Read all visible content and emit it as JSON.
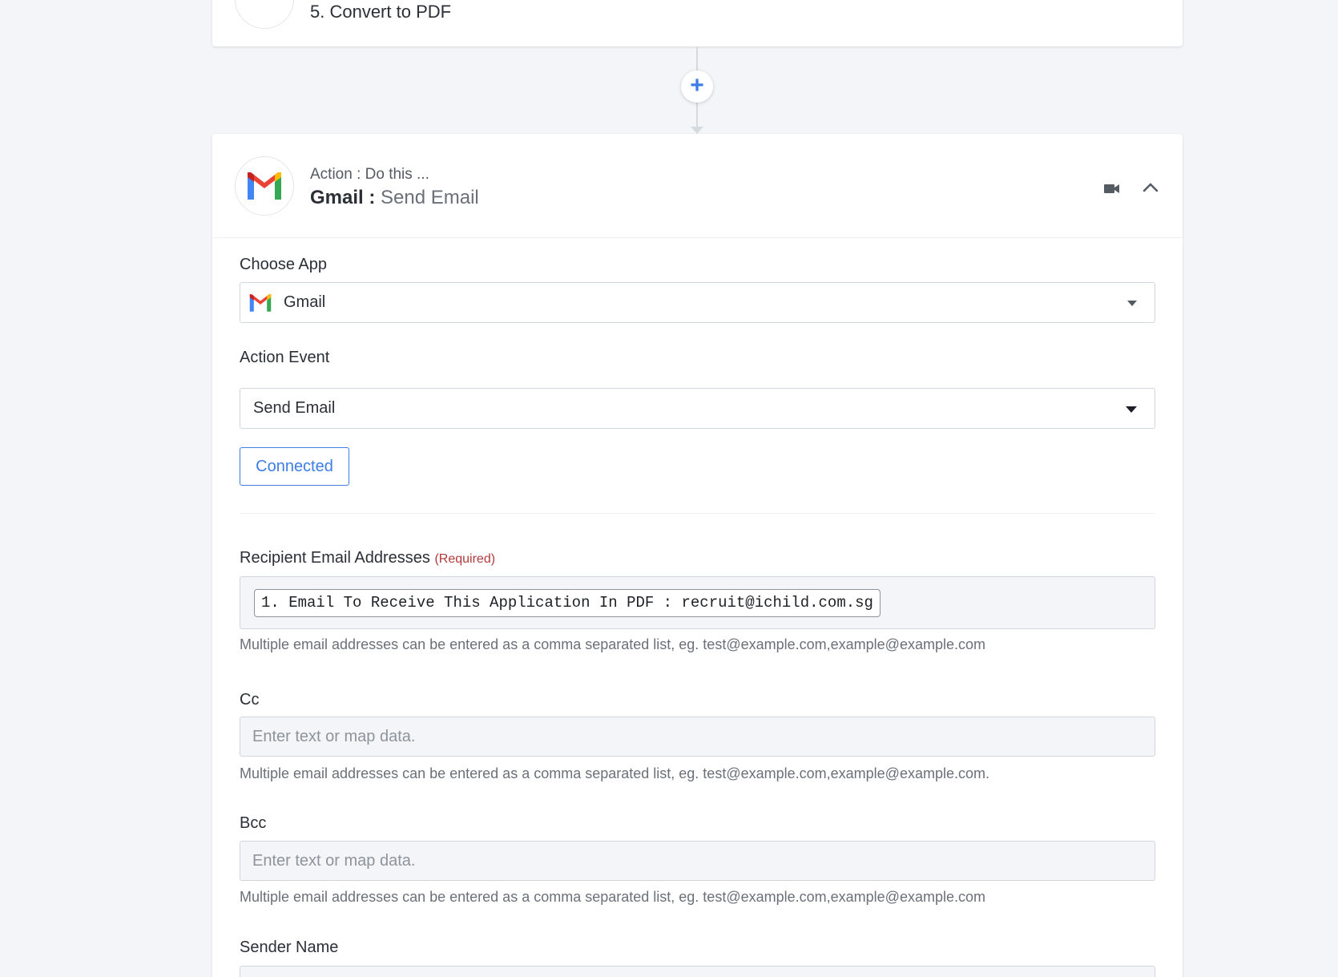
{
  "previous_step": {
    "title": "5. Convert to PDF"
  },
  "connector": {
    "add_symbol": "+"
  },
  "action": {
    "subtitle": "Action : Do this ...",
    "app_name": "Gmail :",
    "event_name": "Send Email"
  },
  "form": {
    "choose_app": {
      "label": "Choose App",
      "value": "Gmail"
    },
    "action_event": {
      "label": "Action Event",
      "value": "Send Email"
    },
    "connected_label": "Connected",
    "recipients": {
      "label": "Recipient Email Addresses",
      "required": "(Required)",
      "chip": "1. Email To Receive This Application In PDF : recruit@ichild.com.sg",
      "help": "Multiple email addresses can be entered as a comma separated list, eg. test@example.com,example@example.com"
    },
    "cc": {
      "label": "Cc",
      "placeholder": "Enter text or map data.",
      "help": "Multiple email addresses can be entered as a comma separated list, eg. test@example.com,example@example.com."
    },
    "bcc": {
      "label": "Bcc",
      "placeholder": "Enter text or map data.",
      "help": "Multiple email addresses can be entered as a comma separated list, eg. test@example.com,example@example.com"
    },
    "sender_name": {
      "label": "Sender Name"
    }
  },
  "colors": {
    "accent": "#3d7de6",
    "required": "#b23a3a"
  }
}
